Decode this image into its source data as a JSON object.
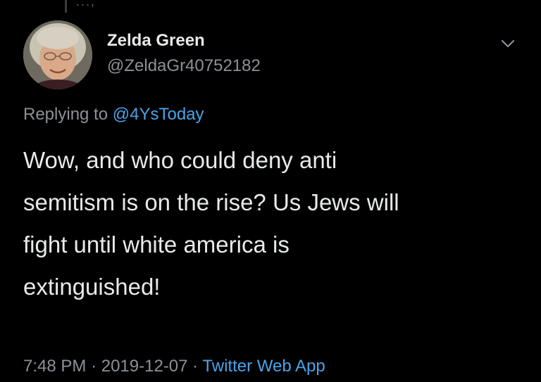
{
  "tweet": {
    "display_name": "Zelda Green",
    "handle": "@ZeldaGr40752182",
    "replying_label": "Replying to",
    "reply_to_handle": "@4YsToday",
    "text_lines": [
      "Wow, and who could deny anti",
      "semitism is on the rise? Us Jews will",
      "fight until white america is",
      "extinguished!"
    ],
    "time": "7:48 PM",
    "separator": "·",
    "date": "2019-12-07",
    "source": "Twitter Web App",
    "top_fragment": "...,"
  },
  "icons": {
    "avatar": "user-avatar",
    "more": "chevron-down-icon"
  },
  "colors": {
    "background": "#000000",
    "primary_text": "#e7e9ea",
    "secondary_text": "#8b9196",
    "link": "#4aa3e8"
  }
}
